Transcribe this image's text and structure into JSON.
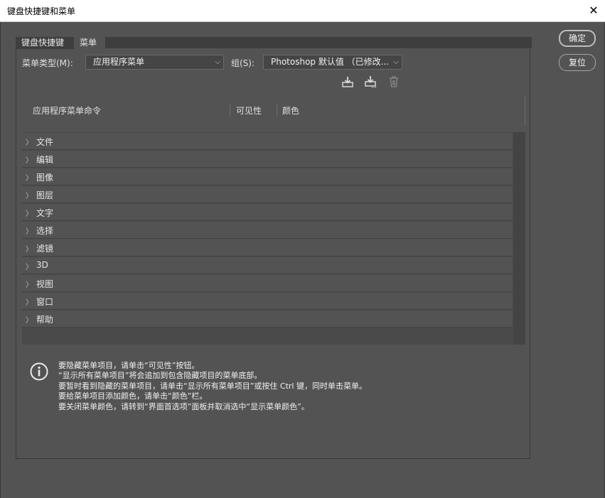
{
  "window": {
    "title": "键盘快捷键和菜单",
    "close_glyph": "✕"
  },
  "tabs": [
    {
      "label": "键盘快捷键"
    },
    {
      "label": "菜单"
    }
  ],
  "buttons": {
    "ok": "确定",
    "reset": "复位"
  },
  "menu_type": {
    "label": "菜单类型(M):",
    "value": "应用程序菜单"
  },
  "group": {
    "label": "组(S):",
    "value": "Photoshop 默认值 （已修改..."
  },
  "icons": [
    "save-set-icon",
    "save-as-set-icon",
    "delete-set-icon"
  ],
  "table_headers": {
    "command": "应用程序菜单命令",
    "visibility": "可见性",
    "color": "颜色"
  },
  "menu_items": [
    "文件",
    "编辑",
    "图像",
    "图层",
    "文字",
    "选择",
    "滤镜",
    "3D",
    "视图",
    "窗口",
    "帮助"
  ],
  "info_lines": [
    "要隐藏菜单项目，请单击“可见性”按钮。",
    "“显示所有菜单项目”将会追加到包含隐藏项目的菜单底部。",
    "要暂时看到隐藏的菜单项目，请单击“显示所有菜单项目”或按住 Ctrl 键，同时单击菜单。",
    "要给菜单项目添加颜色，请单击“颜色”栏。",
    "要关闭菜单颜色，请转到“界面首选项”面板并取消选中“显示菜单颜色”。"
  ]
}
